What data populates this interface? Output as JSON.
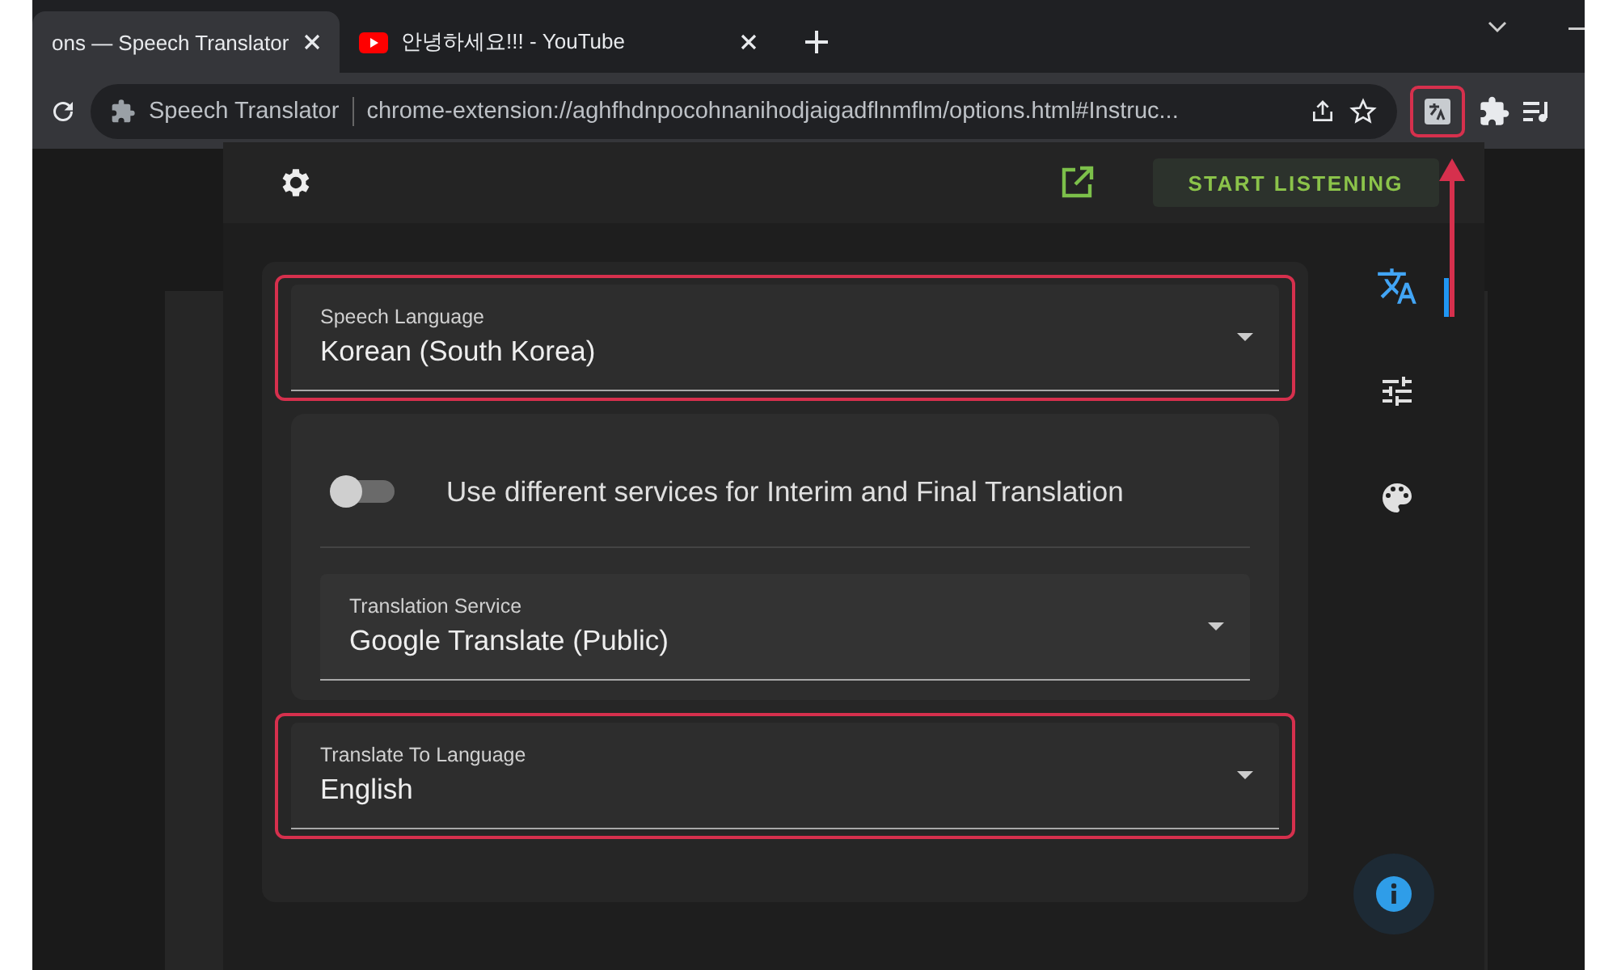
{
  "tabs": [
    {
      "title": "ons — Speech Translator",
      "selected": true
    },
    {
      "title": "안녕하세요!!! - YouTube",
      "selected": false
    }
  ],
  "address_bar": {
    "site_label": "Speech Translator",
    "url": "chrome-extension://aghfhdnpocohnanihodjaigadflnmflm/options.html#Instruc..."
  },
  "toolbar": {
    "extension_highlighted": true
  },
  "popup": {
    "start_button": "START LISTENING",
    "speech_language": {
      "label": "Speech Language",
      "value": "Korean (South Korea)",
      "highlighted": true
    },
    "services": {
      "toggle": {
        "label": "Use different services for Interim and Final Translation",
        "on": false
      },
      "field": {
        "label": "Translation Service",
        "value": "Google Translate (Public)",
        "highlighted": false
      }
    },
    "translate_to": {
      "label": "Translate To Language",
      "value": "English",
      "highlighted": true
    },
    "rail": [
      {
        "kind": "translate",
        "selected": true
      },
      {
        "kind": "tune",
        "selected": false
      },
      {
        "kind": "palette",
        "selected": false
      }
    ]
  }
}
